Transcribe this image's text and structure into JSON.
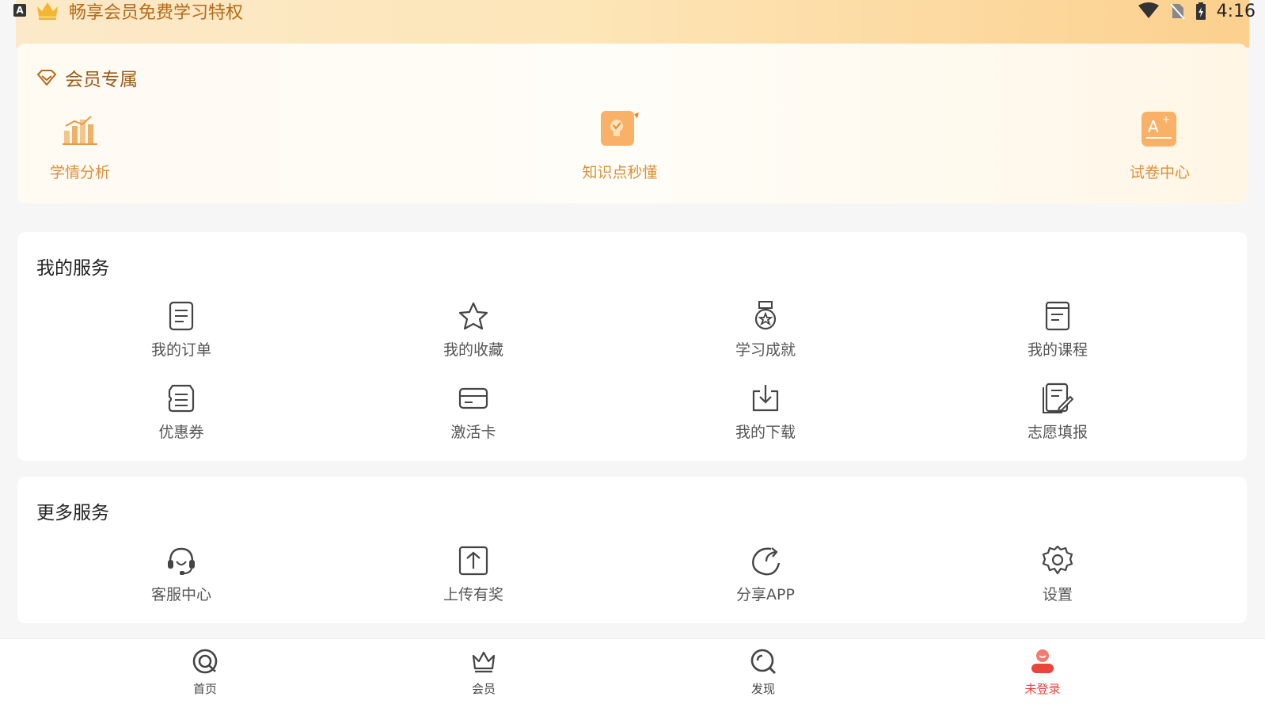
{
  "status_bar": {
    "a_badge": "A",
    "banner_text": "畅享会员免费学习特权",
    "time": "4:16"
  },
  "member": {
    "title": "会员专属",
    "items": [
      {
        "label": "学情分析",
        "icon": "bar-chart-icon"
      },
      {
        "label": "知识点秒懂",
        "icon": "lightbulb-icon"
      },
      {
        "label": "试卷中心",
        "icon": "exam-paper-icon"
      }
    ]
  },
  "my_services": {
    "title": "我的服务",
    "items": [
      {
        "label": "我的订单",
        "icon": "order-document-icon"
      },
      {
        "label": "我的收藏",
        "icon": "star-icon"
      },
      {
        "label": "学习成就",
        "icon": "medal-icon"
      },
      {
        "label": "我的课程",
        "icon": "course-book-icon"
      },
      {
        "label": "优惠券",
        "icon": "coupon-icon"
      },
      {
        "label": "激活卡",
        "icon": "card-icon"
      },
      {
        "label": "我的下载",
        "icon": "download-icon"
      },
      {
        "label": "志愿填报",
        "icon": "edit-form-icon"
      }
    ]
  },
  "more_services": {
    "title": "更多服务",
    "items": [
      {
        "label": "客服中心",
        "icon": "headset-icon"
      },
      {
        "label": "上传有奖",
        "icon": "upload-icon"
      },
      {
        "label": "分享APP",
        "icon": "share-icon"
      },
      {
        "label": "设置",
        "icon": "gear-icon"
      }
    ]
  },
  "bottom_nav": {
    "items": [
      {
        "label": "首页",
        "icon": "home-icon"
      },
      {
        "label": "会员",
        "icon": "crown-icon"
      },
      {
        "label": "发现",
        "icon": "discover-icon"
      },
      {
        "label": "未登录",
        "icon": "user-icon"
      }
    ],
    "active_index": 3
  },
  "colors": {
    "accent_gold": "#d9903c",
    "active_red": "#e8453c"
  }
}
